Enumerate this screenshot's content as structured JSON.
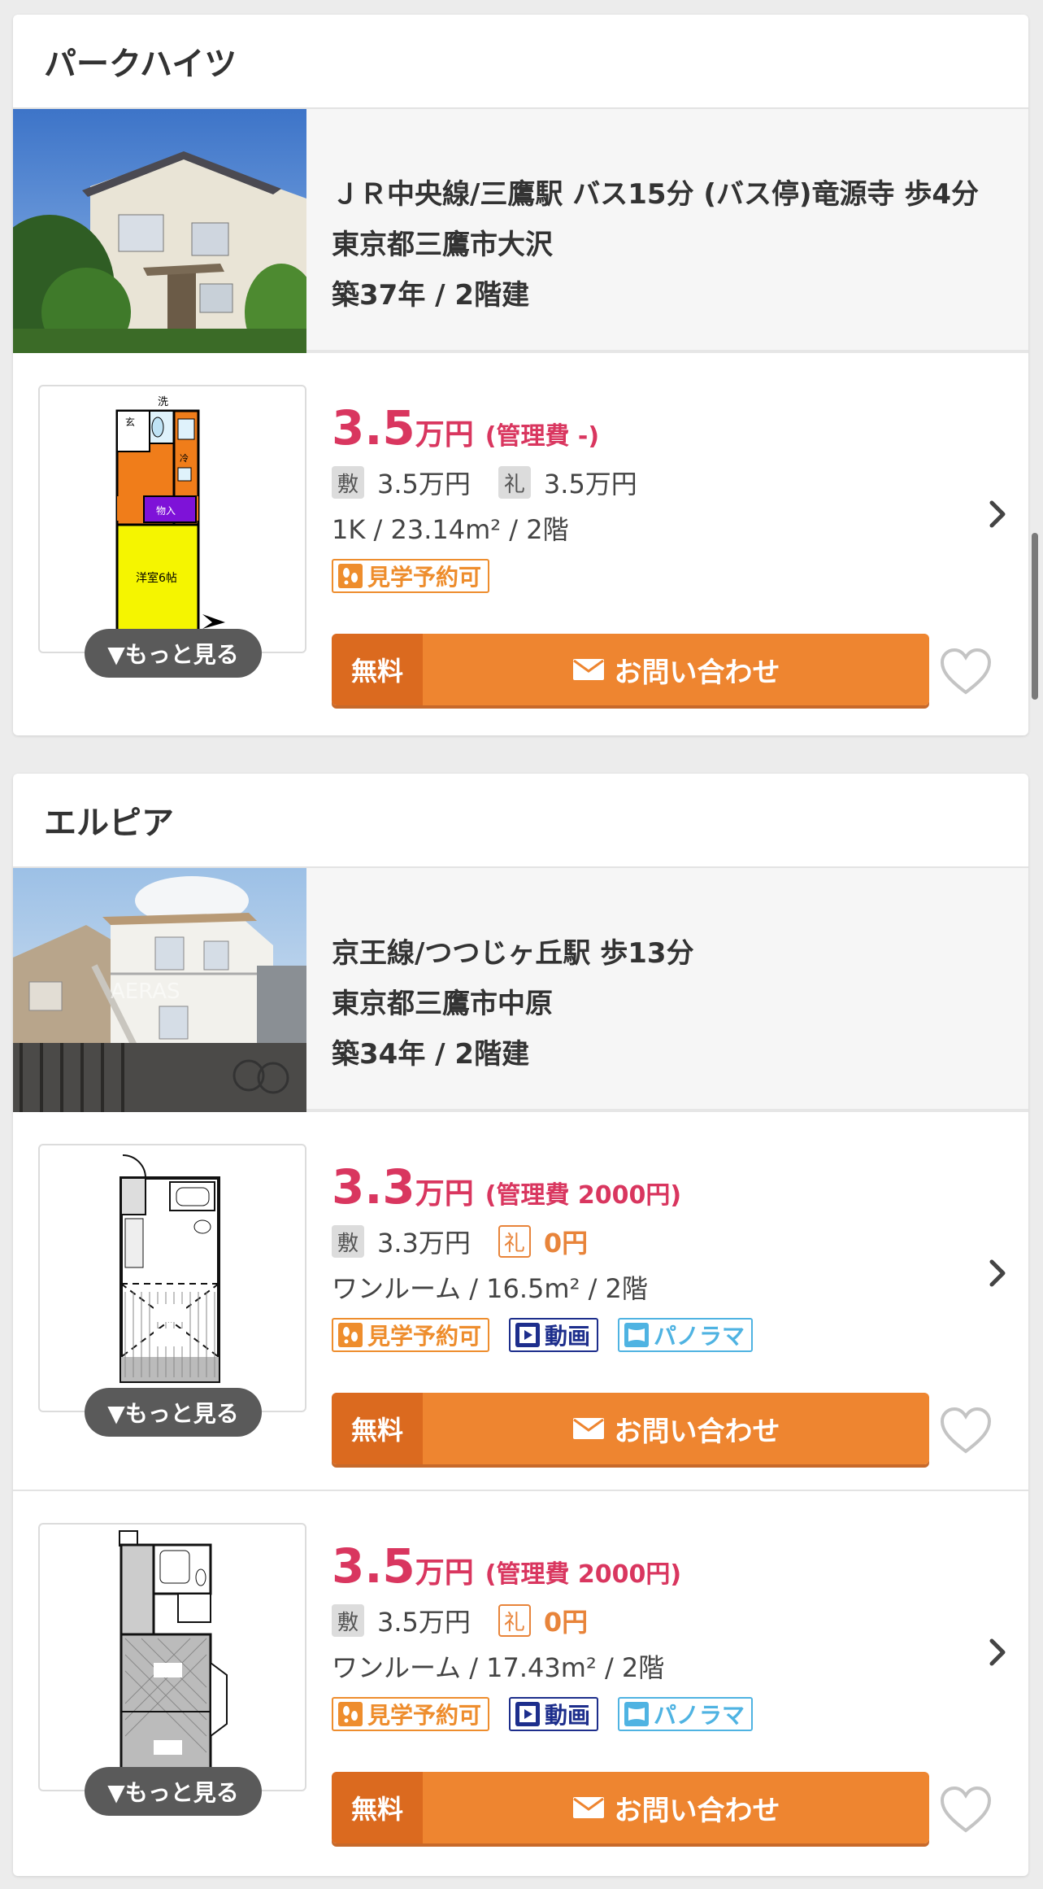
{
  "properties": [
    {
      "name": "パークハイツ",
      "access": "ＪＲ中央線/三鷹駅 バス15分 (バス停)竜源寺 歩4分",
      "address": "東京都三鷹市大沢",
      "age": "築37年 / 2階建",
      "rooms": [
        {
          "price": "3.5",
          "price_unit": "万円",
          "fee": "(管理費 -)",
          "shikikin_label": "敷",
          "shikikin": "3.5万円",
          "reikin_label": "礼",
          "reikin": "3.5万円",
          "layout": "1K /  23.14m² /  2階",
          "badges": [
            "見学予約可"
          ],
          "more_label": "▼もっと見る",
          "free_label": "無料",
          "inquiry_label": "お問い合わせ"
        }
      ]
    },
    {
      "name": "エルピア",
      "access": "京王線/つつじヶ丘駅 歩13分",
      "address": "東京都三鷹市中原",
      "age": "築34年 / 2階建",
      "rooms": [
        {
          "price": "3.3",
          "price_unit": "万円",
          "fee": "(管理費 2000円)",
          "shikikin_label": "敷",
          "shikikin": "3.3万円",
          "reikin_label": "礼",
          "reikin": "0円",
          "layout": "ワンルーム /  16.5m² /  2階",
          "badges": [
            "見学予約可",
            "動画",
            "パノラマ"
          ],
          "more_label": "▼もっと見る",
          "free_label": "無料",
          "inquiry_label": "お問い合わせ"
        },
        {
          "price": "3.5",
          "price_unit": "万円",
          "fee": "(管理費 2000円)",
          "shikikin_label": "敷",
          "shikikin": "3.5万円",
          "reikin_label": "礼",
          "reikin": "0円",
          "layout": "ワンルーム /  17.43m² /  2階",
          "badges": [
            "見学予約可",
            "動画",
            "パノラマ"
          ],
          "more_label": "▼もっと見る",
          "free_label": "無料",
          "inquiry_label": "お問い合わせ"
        }
      ]
    }
  ],
  "floorplan_labels": {
    "wash": "洗",
    "entrance": "玄",
    "fridge": "冷",
    "storage": "物入",
    "room": "洋室6帖"
  },
  "photo_watermark": "AERAS",
  "colors": {
    "price": "#d9365f",
    "inquiry": "#ee8530",
    "inquiry_free": "#db6a1f",
    "badge_visit": "#ee8d2d",
    "badge_video": "#1d2e8c",
    "badge_pano": "#4fb3e2"
  },
  "icons": {
    "visit_badge": "footprints-icon",
    "video_badge": "play-icon",
    "pano_badge": "panorama-icon",
    "inquiry": "envelope-icon",
    "row_arrow": "chevron-right-icon",
    "favorite": "heart-icon"
  }
}
